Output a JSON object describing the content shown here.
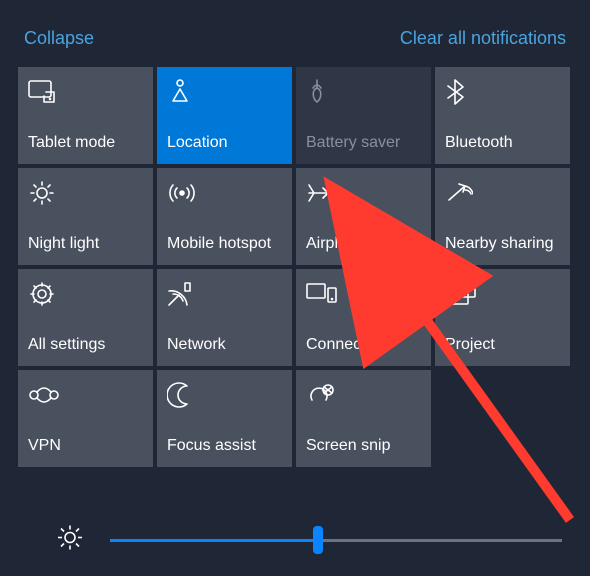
{
  "header": {
    "collapse": "Collapse",
    "clear": "Clear all notifications"
  },
  "tiles": [
    {
      "id": "tablet-mode",
      "label": "Tablet mode",
      "state": "normal",
      "icon": "tablet-mode"
    },
    {
      "id": "location",
      "label": "Location",
      "state": "active",
      "icon": "location"
    },
    {
      "id": "battery-saver",
      "label": "Battery saver",
      "state": "disabled",
      "icon": "battery-saver"
    },
    {
      "id": "bluetooth",
      "label": "Bluetooth",
      "state": "normal",
      "icon": "bluetooth"
    },
    {
      "id": "night-light",
      "label": "Night light",
      "state": "normal",
      "icon": "night-light"
    },
    {
      "id": "mobile-hotspot",
      "label": "Mobile hotspot",
      "state": "normal",
      "icon": "mobile-hotspot"
    },
    {
      "id": "airplane-mode",
      "label": "Airplane mode",
      "state": "normal",
      "icon": "airplane"
    },
    {
      "id": "nearby-sharing",
      "label": "Nearby sharing",
      "state": "normal",
      "icon": "nearby-sharing"
    },
    {
      "id": "all-settings",
      "label": "All settings",
      "state": "normal",
      "icon": "settings"
    },
    {
      "id": "network",
      "label": "Network",
      "state": "normal",
      "icon": "network"
    },
    {
      "id": "connect",
      "label": "Connect",
      "state": "normal",
      "icon": "connect"
    },
    {
      "id": "project",
      "label": "Project",
      "state": "normal",
      "icon": "project"
    },
    {
      "id": "vpn",
      "label": "VPN",
      "state": "normal",
      "icon": "vpn"
    },
    {
      "id": "focus-assist",
      "label": "Focus assist",
      "state": "normal",
      "icon": "focus-assist"
    },
    {
      "id": "screen-snip",
      "label": "Screen snip",
      "state": "normal",
      "icon": "screen-snip"
    }
  ],
  "brightness": {
    "percent": 46
  },
  "annotation": {
    "arrow_target": "airplane-mode",
    "color": "#ff3b30"
  }
}
